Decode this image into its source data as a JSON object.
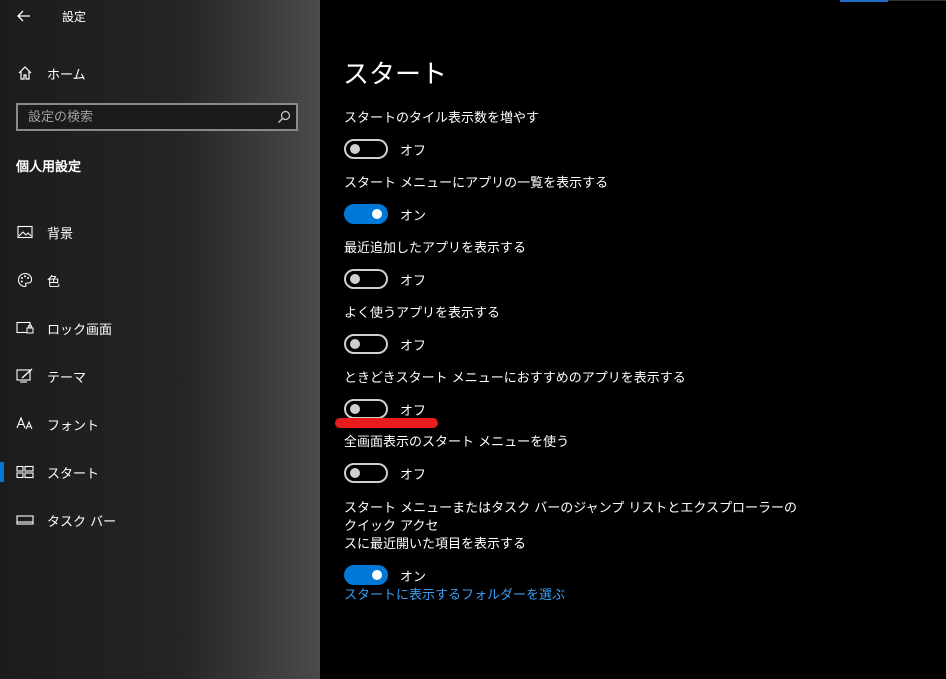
{
  "window": {
    "title": "設定"
  },
  "sidebar": {
    "home_label": "ホーム",
    "search_placeholder": "設定の検索",
    "section_title": "個人用設定",
    "items": [
      {
        "label": "背景",
        "icon": "picture-icon"
      },
      {
        "label": "色",
        "icon": "palette-icon"
      },
      {
        "label": "ロック画面",
        "icon": "lock-screen-icon"
      },
      {
        "label": "テーマ",
        "icon": "theme-icon"
      },
      {
        "label": "フォント",
        "icon": "font-icon"
      },
      {
        "label": "スタート",
        "icon": "start-icon",
        "selected": true
      },
      {
        "label": "タスク バー",
        "icon": "taskbar-icon"
      }
    ]
  },
  "main": {
    "title": "スタート",
    "settings": [
      {
        "label": "スタートのタイル表示数を増やす",
        "state": "オフ",
        "on": false
      },
      {
        "label": "スタート メニューにアプリの一覧を表示する",
        "state": "オン",
        "on": true
      },
      {
        "label": "最近追加したアプリを表示する",
        "state": "オフ",
        "on": false
      },
      {
        "label": "よく使うアプリを表示する",
        "state": "オフ",
        "on": false
      },
      {
        "label": "ときどきスタート メニューにおすすめのアプリを表示する",
        "state": "オフ",
        "on": false
      },
      {
        "label": "全画面表示のスタート メニューを使う",
        "state": "オフ",
        "on": false
      },
      {
        "label_line1": "スタート メニューまたはタスク バーのジャンプ リストとエクスプローラーのクイック アクセ",
        "label_line2": "スに最近開いた項目を表示する",
        "state": "オン",
        "on": true
      }
    ],
    "link": "スタートに表示するフォルダーを選ぶ"
  },
  "colors": {
    "accent": "#0078d7",
    "link": "#3b9cf0",
    "annotation": "#e81c1c"
  }
}
